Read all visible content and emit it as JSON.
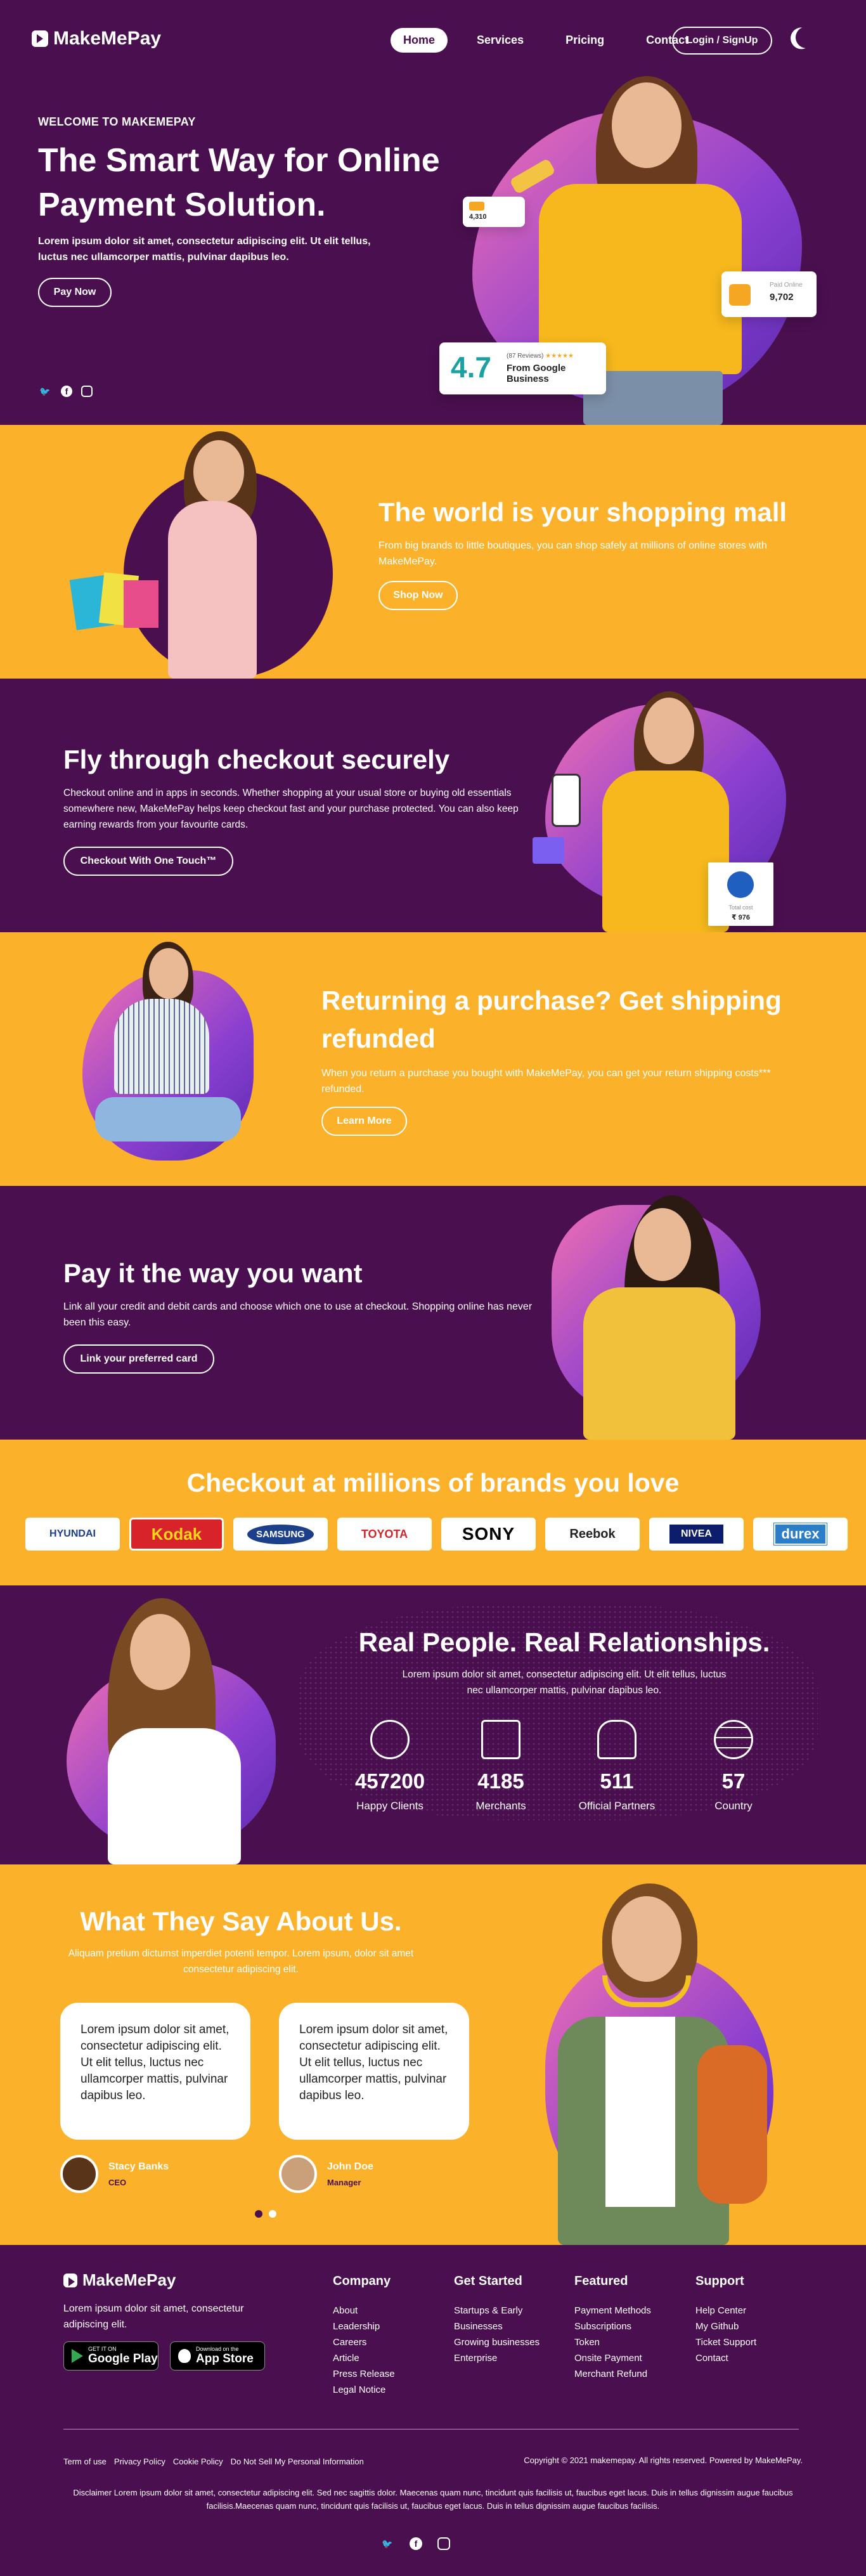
{
  "colors": {
    "purple": "#4a0f4f",
    "yellow": "#fbb22a",
    "white": "#ffffff"
  },
  "brand": {
    "name": "MakeMePay"
  },
  "nav": {
    "items": [
      "Home",
      "Services",
      "Pricing",
      "Contact"
    ],
    "active": "Home",
    "login": "Login / SignUp",
    "theme_icon": "moon-icon"
  },
  "hero": {
    "kicker": "WELCOME TO MAKEMEPAY",
    "title": "The Smart Way for Online Payment Solution.",
    "desc": "Lorem ipsum dolor sit amet, consectetur adipiscing elit. Ut elit tellus, luctus nec ullamcorper mattis, pulvinar dapibus leo.",
    "button": "Pay Now",
    "socials": [
      "twitter-icon",
      "facebook-icon",
      "instagram-icon"
    ],
    "card_small": "4,310",
    "card_right_label": "Paid Online",
    "card_right_value": "9,702",
    "rating": "4.7",
    "reviews": "(87 Reviews)",
    "stars": "★★★★★",
    "source": "From Google Business"
  },
  "s1": {
    "title": "The world is your shopping mall",
    "desc": "From big brands to little boutiques, you can shop safely at millions of online stores with MakeMePay.",
    "button": "Shop Now"
  },
  "s2": {
    "title": "Fly through checkout securely",
    "desc": "Checkout online and in apps in seconds. Whether shopping at your usual store or buying old essentials somewhere new, MakeMePay helps keep checkout fast and your purchase protected. You can also keep earning rewards from your favourite cards.",
    "button": "Checkout With One Touch™",
    "badge_label": "Total cost",
    "badge_value": "₹ 976"
  },
  "s3": {
    "title": "Returning a purchase? Get shipping refunded",
    "desc": "When you return a purchase you bought with MakeMePay, you can get your return shipping costs*** refunded.",
    "button": "Learn More"
  },
  "s4": {
    "title": "Pay it the way you want",
    "desc": "Link all your credit and debit cards and choose which one to use at checkout. Shopping online has never been this easy.",
    "button": "Link your preferred card"
  },
  "brands": {
    "title": "Checkout at millions of brands you love",
    "items": [
      "HYUNDAI",
      "Kodak",
      "SAMSUNG",
      "TOYOTA",
      "SONY",
      "Reebok",
      "NIVEA",
      "durex"
    ]
  },
  "people": {
    "title": "Real People. Real Relationships.",
    "desc": "Lorem ipsum dolor sit amet, consectetur adipiscing elit. Ut elit tellus, luctus nec ullamcorper mattis, pulvinar dapibus leo.",
    "stats": [
      {
        "num": "457200",
        "label": "Happy Clients",
        "icon": "user-icon"
      },
      {
        "num": "4185",
        "label": "Merchants",
        "icon": "basket-icon"
      },
      {
        "num": "511",
        "label": "Official Partners",
        "icon": "partner-icon"
      },
      {
        "num": "57",
        "label": "Country",
        "icon": "globe-icon"
      }
    ]
  },
  "testimonials": {
    "title": "What They Say About Us.",
    "desc": "Aliquam pretium dictumst imperdiet potenti tempor. Lorem ipsum, dolor sit amet consectetur adipiscing elit.",
    "items": [
      {
        "text": "Lorem ipsum dolor sit amet, consectetur adipiscing elit. Ut elit tellus, luctus nec ullamcorper mattis, pulvinar dapibus leo.",
        "name": "Stacy Banks",
        "role": "CEO"
      },
      {
        "text": "Lorem ipsum dolor sit amet, consectetur adipiscing elit. Ut elit tellus, luctus nec ullamcorper mattis, pulvinar dapibus leo.",
        "name": "John Doe",
        "role": "Manager"
      }
    ]
  },
  "footer": {
    "tagline": "Lorem ipsum dolor sit amet, consectetur adipiscing elit.",
    "google_small": "GET IT ON",
    "google_big": "Google Play",
    "apple_small": "Download on the",
    "apple_big": "App Store",
    "cols": [
      {
        "title": "Company",
        "links": [
          "About",
          "Leadership",
          "Careers",
          "Article",
          "Press Release",
          "Legal Notice"
        ]
      },
      {
        "title": "Get Started",
        "links": [
          "Startups & Early",
          "Businesses",
          "Growing businesses",
          "Enterprise"
        ]
      },
      {
        "title": "Featured",
        "links": [
          "Payment Methods",
          "Subscriptions",
          "Token",
          "Onsite Payment",
          "Merchant Refund"
        ]
      },
      {
        "title": "Support",
        "links": [
          "Help Center",
          "My Github",
          "Ticket Support",
          "Contact"
        ]
      }
    ],
    "legal": [
      "Term of use",
      "Privacy Policy",
      "Cookie Policy",
      "Do Not Sell My Personal Information"
    ],
    "copyright": "Copyright © 2021 makemepay. All rights reserved. Powered by MakeMePay.",
    "disclaimer": "Disclaimer Lorem ipsum dolor sit amet, consectetur adipiscing elit. Sed nec sagittis dolor. Maecenas quam nunc, tincidunt quis facilisis ut, faucibus eget lacus. Duis in tellus dignissim augue faucibus facilisis.Maecenas quam nunc, tincidunt quis facilisis ut, faucibus eget lacus. Duis in tellus dignissim augue faucibus facilisis."
  }
}
